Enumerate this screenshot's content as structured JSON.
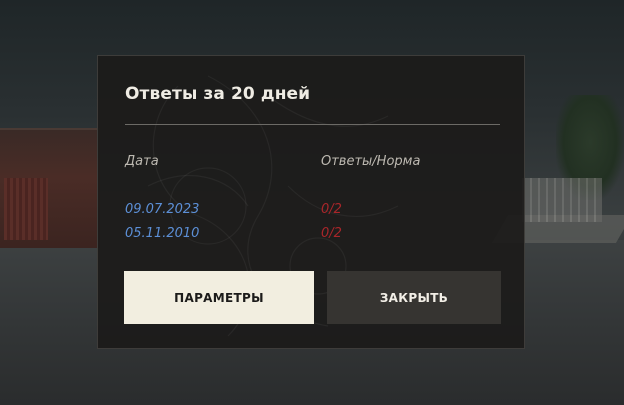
{
  "dialog": {
    "title": "Ответы за 20 дней",
    "columns": {
      "date": "Дата",
      "answers": "Ответы/Норма"
    },
    "rows": [
      {
        "date": "09.07.2023",
        "answers": "0/2"
      },
      {
        "date": "05.11.2010",
        "answers": "0/2"
      }
    ],
    "buttons": {
      "params_label": "ПАРАМЕТРЫ",
      "close_label": "ЗАКРЫТЬ"
    }
  },
  "colors": {
    "date_text": "#5c8fd6",
    "answers_text": "#a8262a",
    "primary_button_bg": "#f2eee0",
    "secondary_button_bg": "#363431"
  },
  "icons": [
    "ornament-background"
  ]
}
